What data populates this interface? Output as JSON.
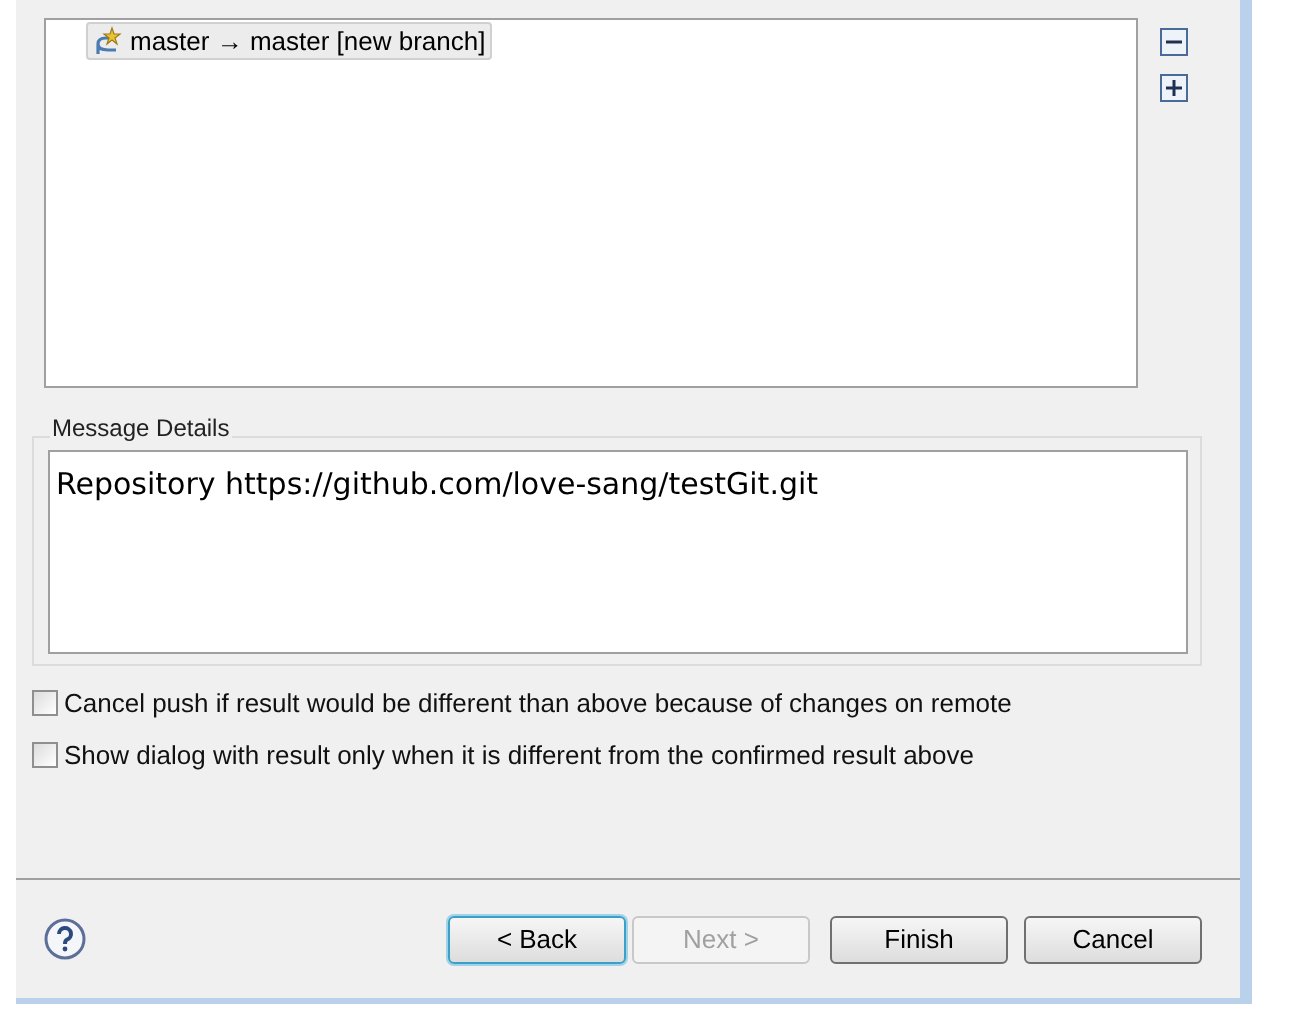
{
  "tree": {
    "items": [
      {
        "label": "master → master [new branch]",
        "selected": true
      }
    ]
  },
  "message_details": {
    "title": "Message Details",
    "text": "Repository https://github.com/love-sang/testGit.git"
  },
  "options": [
    {
      "label": "Cancel push if result would be different than above because of changes on remote",
      "checked": false
    },
    {
      "label": "Show dialog with result only when it is different from the confirmed result above",
      "checked": false
    }
  ],
  "buttons": [
    {
      "label": "< Back",
      "disabled": false,
      "focused": true
    },
    {
      "label": "Next >",
      "disabled": true,
      "focused": false
    },
    {
      "label": "Finish",
      "disabled": false,
      "focused": false
    },
    {
      "label": "Cancel",
      "disabled": false,
      "focused": false
    }
  ]
}
